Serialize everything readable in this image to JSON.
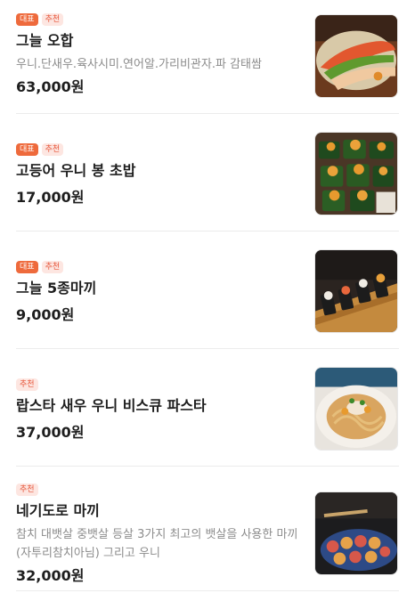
{
  "menu": {
    "items": [
      {
        "badges": [
          {
            "label": "대표",
            "kind": "rep"
          },
          {
            "label": "추천",
            "kind": "rec"
          }
        ],
        "name": "그늘 오합",
        "description": "우니.단새우.육사시미.연어알.가리비관자.파 감태쌈",
        "price": "63,000원",
        "image": "sashimi-platter-photo"
      },
      {
        "badges": [
          {
            "label": "대표",
            "kind": "rep"
          },
          {
            "label": "추천",
            "kind": "rec"
          }
        ],
        "name": "고등어 우니 봉 초밥",
        "description": "",
        "price": "17,000원",
        "image": "mackerel-uni-sushi-photo"
      },
      {
        "badges": [
          {
            "label": "대표",
            "kind": "rep"
          },
          {
            "label": "추천",
            "kind": "rec"
          }
        ],
        "name": "그늘 5종마끼",
        "description": "",
        "price": "9,000원",
        "image": "maki-rolls-photo"
      },
      {
        "badges": [
          {
            "label": "추천",
            "kind": "rec"
          }
        ],
        "name": "랍스타 새우 우니 비스큐 파스타",
        "description": "",
        "price": "37,000원",
        "image": "bisque-pasta-photo"
      },
      {
        "badges": [
          {
            "label": "추천",
            "kind": "rec"
          }
        ],
        "name": "네기도로 마끼",
        "description": "참치 대뱃살 중뱃살 등살 3가지 최고의 뱃살을 사용한 마끼(자투리참치아님) 그리고 우니",
        "price": "32,000원",
        "image": "negitoro-maki-photo"
      }
    ]
  },
  "colors": {
    "rep_badge_bg": "#ee6a3c",
    "rec_badge_bg": "#fde6e1",
    "rec_badge_text": "#e6553a",
    "description_text": "#8c8c8c"
  }
}
